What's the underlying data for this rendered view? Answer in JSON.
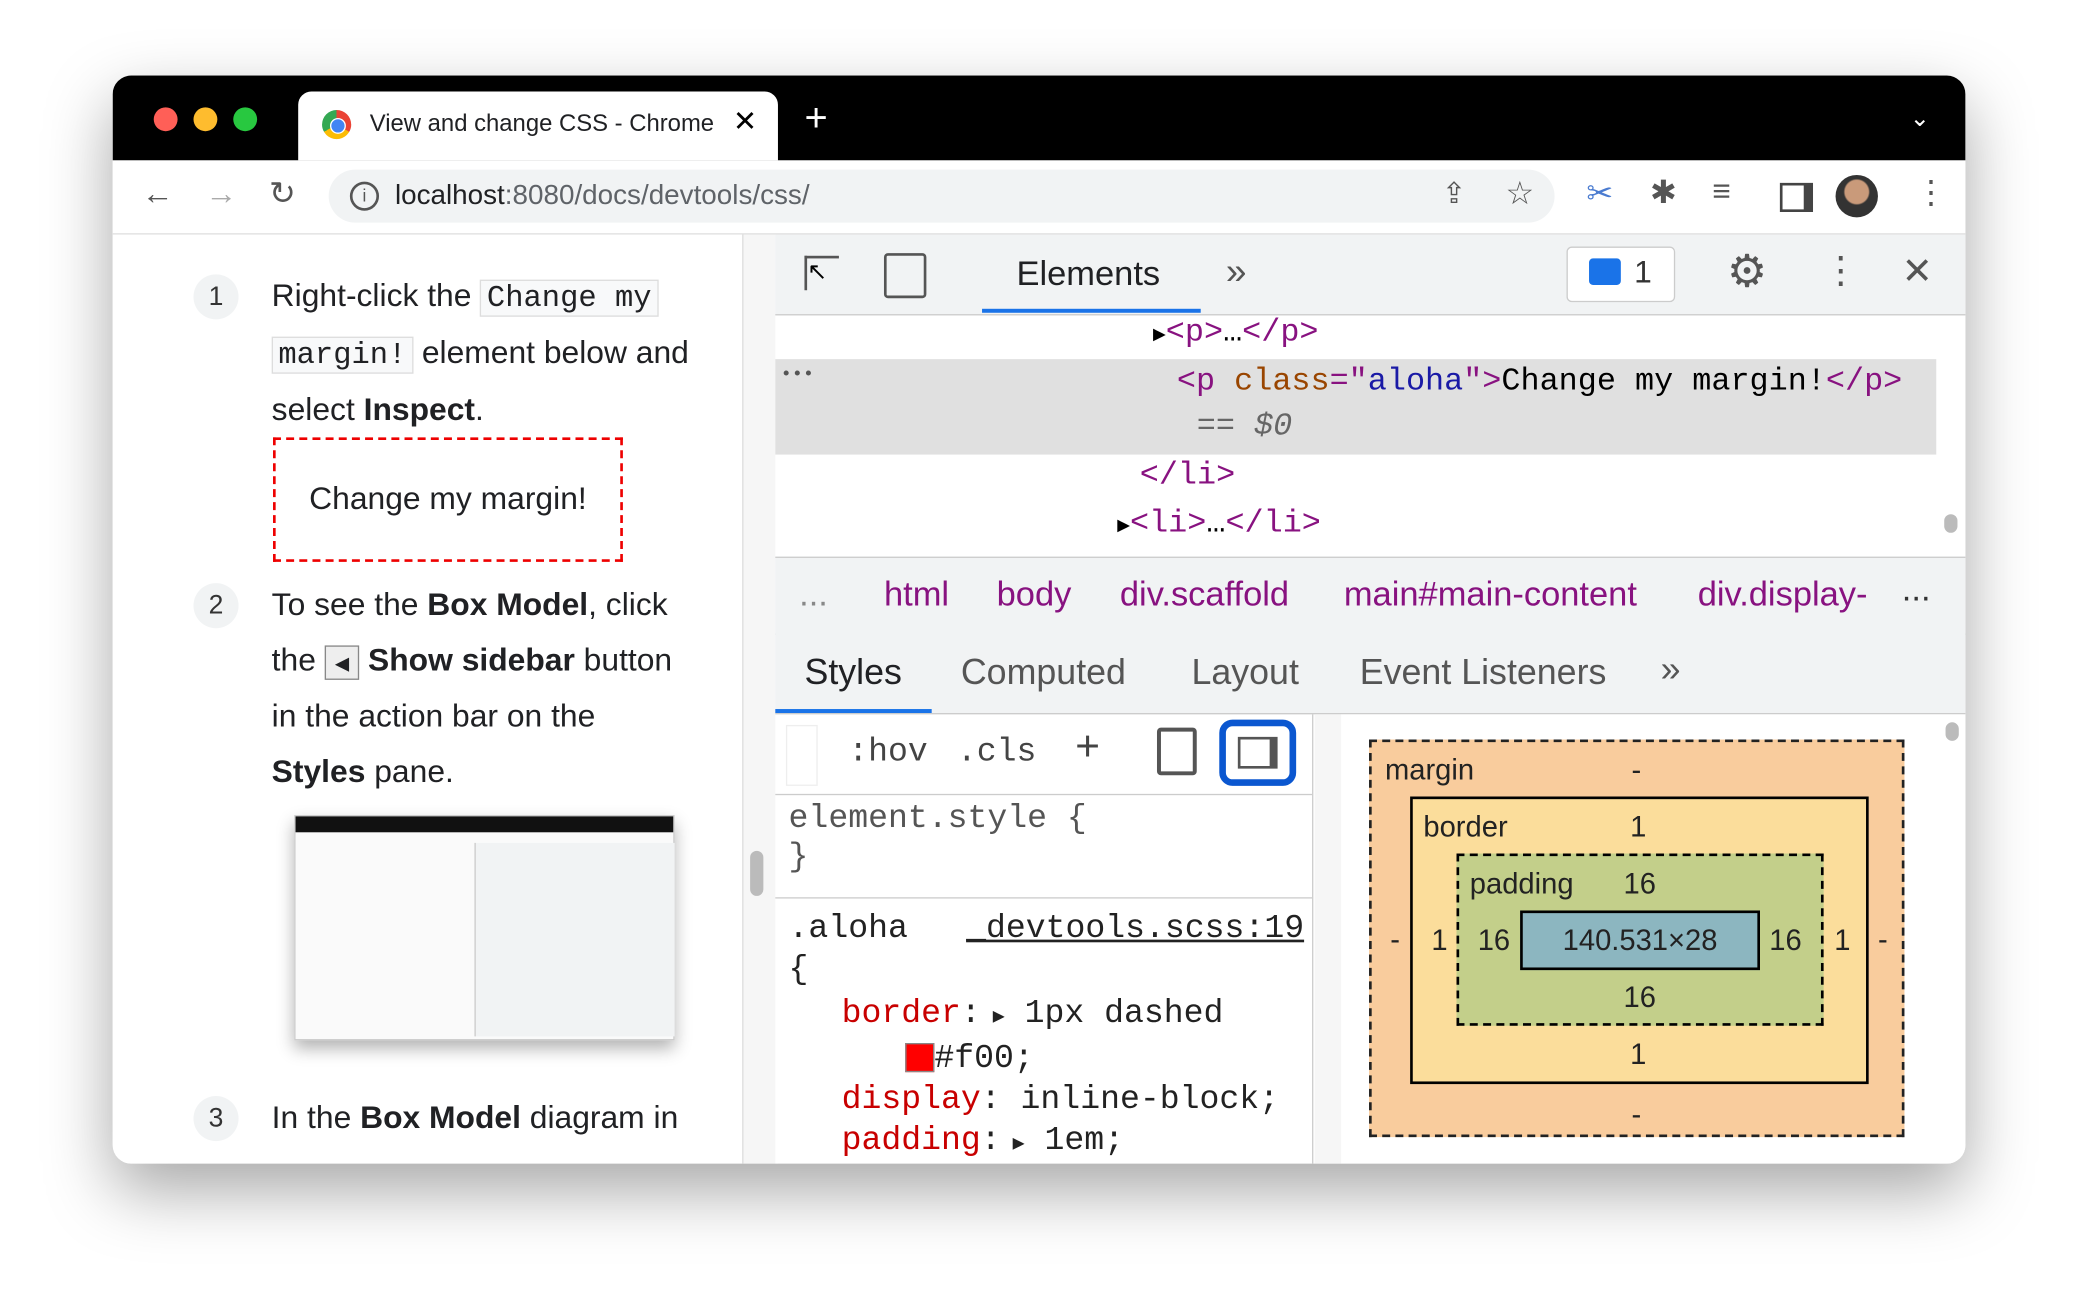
{
  "browser": {
    "tab_title": "View and change CSS - Chrome",
    "url_host": "localhost",
    "url_path": ":8080/docs/devtools/css/"
  },
  "page": {
    "step1": {
      "num": "1",
      "t1": "Right-click the",
      "code1": "Change my",
      "code2": "margin!",
      "t2": "element below and",
      "t3": "select ",
      "b1": "Inspect",
      "t4": "."
    },
    "demo_box": "Change my margin!",
    "step2": {
      "num": "2",
      "t1": "To see the ",
      "b1": "Box Model",
      "t2": ", click",
      "t3": "the ",
      "b2": "Show sidebar",
      "t4": " button",
      "t5": "in the action bar on the",
      "b3": "Styles",
      "t6": " pane."
    },
    "step3": {
      "num": "3",
      "t1": "In the ",
      "b1": "Box Model",
      "t2": " diagram in"
    }
  },
  "devtools": {
    "tab_elements": "Elements",
    "more": "»",
    "issues_count": "1",
    "dom": {
      "l1_open": "<p>",
      "l1_ell": "…",
      "l1_close": "</p>",
      "l2_open": "<p ",
      "l2_attr": "class",
      "l2_eq": "=\"",
      "l2_val": "aloha",
      "l2_q": "\">",
      "l2_text": "Change my margin!",
      "l2_close": "</p>",
      "l2_sel": "== $0",
      "l3": "</li>",
      "l4_open": "<li>",
      "l4_ell": "…",
      "l4_close": "</li>",
      "dots": "•••"
    },
    "breadcrumbs": [
      "html",
      "body",
      "div.scaffold",
      "main#main-content",
      "div.display-"
    ],
    "crumb_more": "...",
    "panel_tabs": [
      "Styles",
      "Computed",
      "Layout",
      "Event Listeners"
    ],
    "filter": {
      "hov": ":hov",
      "cls": ".cls",
      "plus": "+"
    },
    "rules": {
      "element_style": "element.style {",
      "close": "}",
      "aloha_sel": ".aloha",
      "aloha_src": "_devtools.scss:19",
      "open": "{",
      "decls": [
        {
          "p": "border",
          "v": "1px dashed"
        },
        {
          "p": "",
          "v": "#f00;"
        },
        {
          "p": "display",
          "v": "inline-block;"
        },
        {
          "p": "padding",
          "v": "1em;"
        }
      ],
      "swatch_color": "#ff0000"
    },
    "box_model": {
      "margin_label": "margin",
      "margin_top": "-",
      "margin_bottom": "-",
      "margin_left": "-",
      "margin_right": "-",
      "border_label": "border",
      "border_top": "1",
      "border_bottom": "1",
      "border_left": "1",
      "border_right": "1",
      "padding_label": "padding",
      "padding_top": "16",
      "padding_bottom": "16",
      "padding_left": "16",
      "padding_right": "16",
      "content": "140.531×28"
    }
  }
}
